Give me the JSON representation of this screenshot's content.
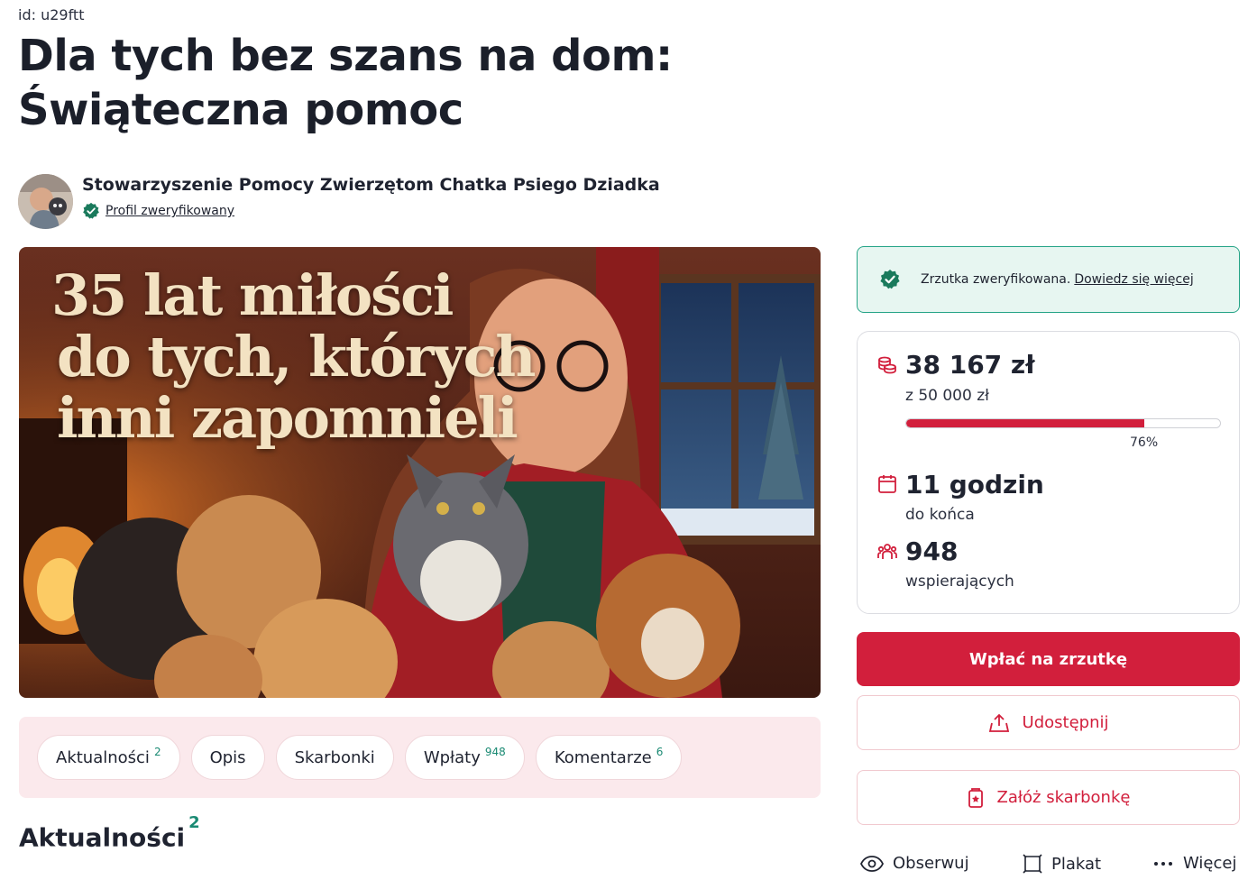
{
  "page": {
    "id_text": "id: u29ftt",
    "title_line1": "Dla tych bez szans na dom:",
    "title_line2": "Świąteczna pomoc"
  },
  "organizer": {
    "name": "Stowarzyszenie Pomocy Zwierzętom Chatka Psiego Dziadka",
    "verified_label": "Profil zweryfikowany"
  },
  "hero": {
    "line1": "35 lat miłości",
    "line2": "do tych, których",
    "line3": "inni zapomnieli"
  },
  "tabs": [
    {
      "label": "Aktualności",
      "count": "2"
    },
    {
      "label": "Opis",
      "count": ""
    },
    {
      "label": "Skarbonki",
      "count": ""
    },
    {
      "label": "Wpłaty",
      "count": "948"
    },
    {
      "label": "Komentarze",
      "count": "6"
    }
  ],
  "section": {
    "title": "Aktualności",
    "count": "2"
  },
  "verification": {
    "text": "Zrzutka zweryfikowana.",
    "link": "Dowiedz się więcej"
  },
  "stats": {
    "raised": "38 167 zł",
    "goal": "z 50 000 zł",
    "progress_percent": 76,
    "progress_label": "76%",
    "time_left": "11 godzin",
    "time_left_sub": "do końca",
    "supporters": "948",
    "supporters_sub": "wspierających"
  },
  "buttons": {
    "donate": "Wpłać na zrzutkę",
    "share": "Udostępnij",
    "piggybank": "Załóż skarbonkę"
  },
  "actions": {
    "follow": "Obserwuj",
    "poster": "Plakat",
    "more": "Więcej"
  },
  "colors": {
    "accent": "#d21f3c",
    "verified_green": "#25a487",
    "tab_bar_bg": "#fbe9ec"
  }
}
